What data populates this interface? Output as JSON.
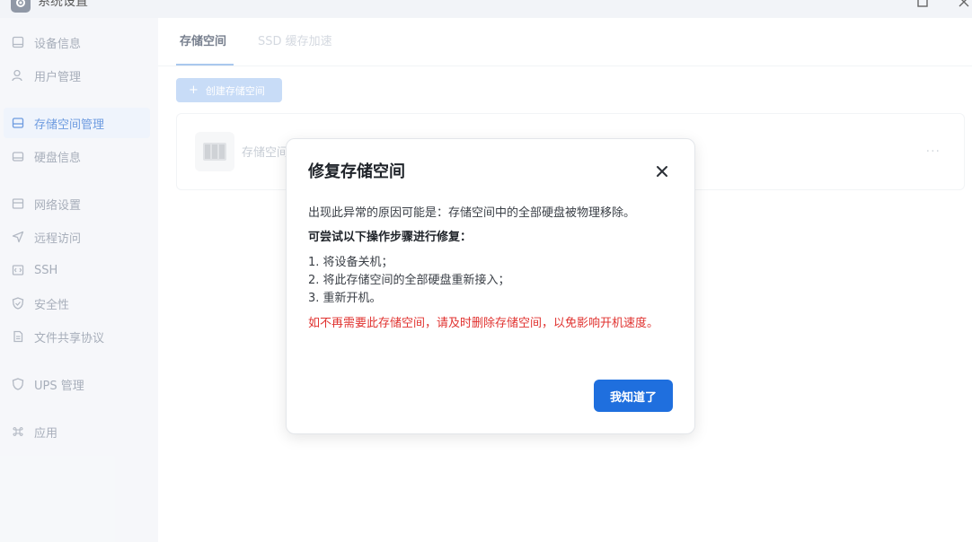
{
  "window": {
    "title": "系统设置",
    "app_icon": "gear-icon"
  },
  "sidebar": {
    "items": [
      {
        "label": "设备信息",
        "icon": "device-icon",
        "active": false
      },
      {
        "label": "用户管理",
        "icon": "user-icon",
        "active": false
      },
      {
        "label": "存储空间管理",
        "icon": "storage-icon",
        "active": true
      },
      {
        "label": "硬盘信息",
        "icon": "disk-icon",
        "active": false
      },
      {
        "label": "网络设置",
        "icon": "network-icon",
        "active": false
      },
      {
        "label": "远程访问",
        "icon": "send-icon",
        "active": false
      },
      {
        "label": "SSH",
        "icon": "code-icon",
        "active": false
      },
      {
        "label": "安全性",
        "icon": "shield-check-icon",
        "active": false
      },
      {
        "label": "文件共享协议",
        "icon": "file-icon",
        "active": false
      },
      {
        "label": "UPS 管理",
        "icon": "shield-icon",
        "active": false
      },
      {
        "label": "应用",
        "icon": "command-icon",
        "active": false
      }
    ]
  },
  "main": {
    "tabs": [
      {
        "label": "存储空间",
        "active": true
      },
      {
        "label": "SSD 缓存加速",
        "active": false
      }
    ],
    "create_button": "创建存储空间",
    "storage_card": {
      "name": "存储空间",
      "more": "···"
    }
  },
  "modal": {
    "title": "修复存储空间",
    "cause": "出现此异常的原因可能是：存储空间中的全部硬盘被物理移除。",
    "steps_heading": "可尝试以下操作步骤进行修复：",
    "steps": [
      "1. 将设备关机；",
      "2. 将此存储空间的全部硬盘重新接入；",
      "3. 重新开机。"
    ],
    "warning": "如不再需要此存储空间，请及时删除存储空间，以免影响开机速度。",
    "confirm_button": "我知道了"
  },
  "colors": {
    "accent": "#1f6fde",
    "warning": "#e0322f",
    "sidebar_active_bg": "#eaf1fb"
  }
}
